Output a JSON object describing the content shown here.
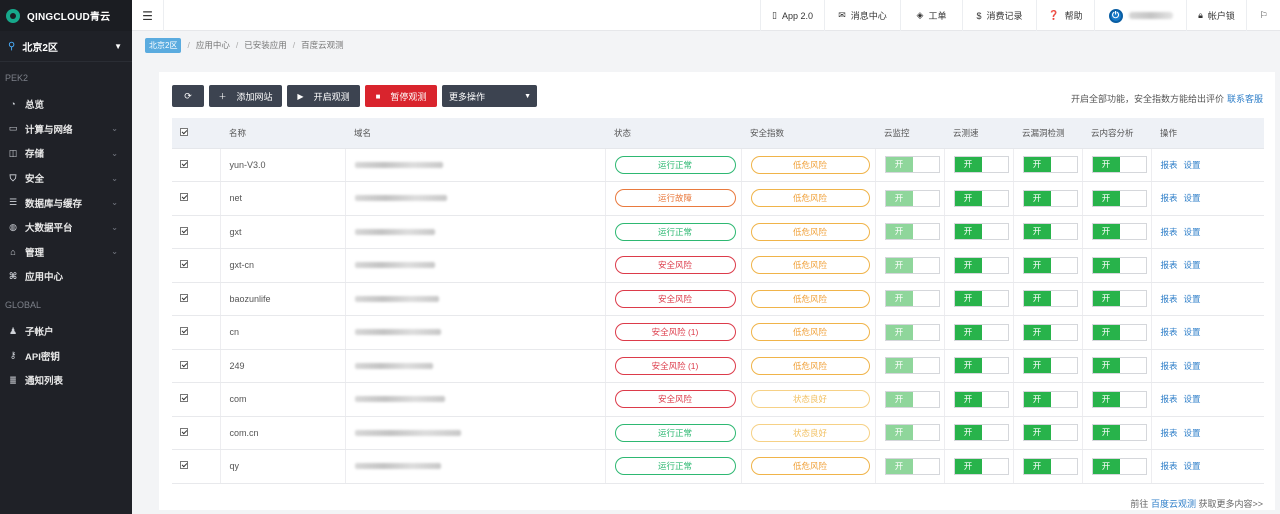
{
  "brand": {
    "logo_text": "QINGCLOUD青云"
  },
  "sidebar": {
    "region": "北京2区",
    "groups": [
      {
        "label": "PEK2",
        "items": [
          {
            "label": "总览",
            "icon": "dashboard-icon",
            "glyph": "◔",
            "chev": false
          },
          {
            "label": "计算与网络",
            "icon": "monitor-icon",
            "glyph": "▭",
            "chev": true
          },
          {
            "label": "存储",
            "icon": "storage-icon",
            "glyph": "◫",
            "chev": true
          },
          {
            "label": "安全",
            "icon": "shield-icon",
            "glyph": "⛉",
            "chev": true
          },
          {
            "label": "数据库与缓存",
            "icon": "database-icon",
            "glyph": "☰",
            "chev": true
          },
          {
            "label": "大数据平台",
            "icon": "globe-icon",
            "glyph": "◍",
            "chev": true
          },
          {
            "label": "管理",
            "icon": "graduation-cap-icon",
            "glyph": "⌂",
            "chev": true
          },
          {
            "label": "应用中心",
            "icon": "app-center-icon",
            "glyph": "⌘",
            "chev": false
          }
        ]
      },
      {
        "label": "GLOBAL",
        "items": [
          {
            "label": "子帐户",
            "icon": "users-icon",
            "glyph": "♟",
            "chev": false
          },
          {
            "label": "API密钥",
            "icon": "key-icon",
            "glyph": "⚷",
            "chev": false
          },
          {
            "label": "通知列表",
            "icon": "list-icon",
            "glyph": "≣",
            "chev": false
          }
        ]
      }
    ]
  },
  "topnav": {
    "app": "App 2.0",
    "messages": "消息中心",
    "tickets": "工单",
    "billing": "消费记录",
    "help": "帮助",
    "account": "帐户锁"
  },
  "breadcrumb": {
    "region": "北京2区",
    "items": [
      "应用中心",
      "已安装应用",
      "百度云观测"
    ]
  },
  "toolbar": {
    "add": "添加网站",
    "start": "开启观测",
    "stop": "暂停观测",
    "more": "更多操作"
  },
  "notice": {
    "text": "开启全部功能，安全指数方能给出评价",
    "link": "联系客服"
  },
  "table": {
    "headers": [
      "名称",
      "域名",
      "状态",
      "安全指数",
      "云监控",
      "云测速",
      "云漏洞检测",
      "云内容分析",
      "操作"
    ],
    "toggle_label": "开",
    "action_report": "报表",
    "action_settings": "设置",
    "rows": [
      {
        "name": "yun-V3.0",
        "status": "运行正常",
        "status_type": "ok",
        "security": "低危风险",
        "security_type": "orange",
        "monitor": "light",
        "blur": 88
      },
      {
        "name": "net",
        "status": "运行故障",
        "status_type": "fault",
        "security": "低危风险",
        "security_type": "orange",
        "monitor": "light",
        "blur": 92
      },
      {
        "name": "gxt",
        "status": "运行正常",
        "status_type": "ok",
        "security": "低危风险",
        "security_type": "orange",
        "monitor": "light",
        "blur": 80
      },
      {
        "name": "gxt-cn",
        "status": "安全风险",
        "status_type": "risk",
        "security": "低危风险",
        "security_type": "orange",
        "monitor": "light",
        "blur": 80
      },
      {
        "name": "baozunlife",
        "status": "安全风险",
        "status_type": "risk",
        "security": "低危风险",
        "security_type": "orange",
        "monitor": "light",
        "blur": 84
      },
      {
        "name": "cn",
        "status": "安全风险 (1)",
        "status_type": "risk",
        "security": "低危风险",
        "security_type": "orange",
        "monitor": "light",
        "blur": 86
      },
      {
        "name": "249",
        "status": "安全风险 (1)",
        "status_type": "risk",
        "security": "低危风险",
        "security_type": "orange",
        "monitor": "light",
        "blur": 78
      },
      {
        "name": "com",
        "status": "安全风险",
        "status_type": "risk",
        "security": "状态良好",
        "security_type": "good",
        "monitor": "light",
        "blur": 90
      },
      {
        "name": "com.cn",
        "status": "运行正常",
        "status_type": "ok",
        "security": "状态良好",
        "security_type": "good",
        "monitor": "light",
        "blur": 106
      },
      {
        "name": "qy",
        "status": "运行正常",
        "status_type": "ok",
        "security": "低危风险",
        "security_type": "orange",
        "monitor": "light",
        "blur": 86
      }
    ]
  },
  "footer": {
    "prefix": "前往",
    "link": "百度云观测",
    "suffix": "获取更多内容>>"
  }
}
